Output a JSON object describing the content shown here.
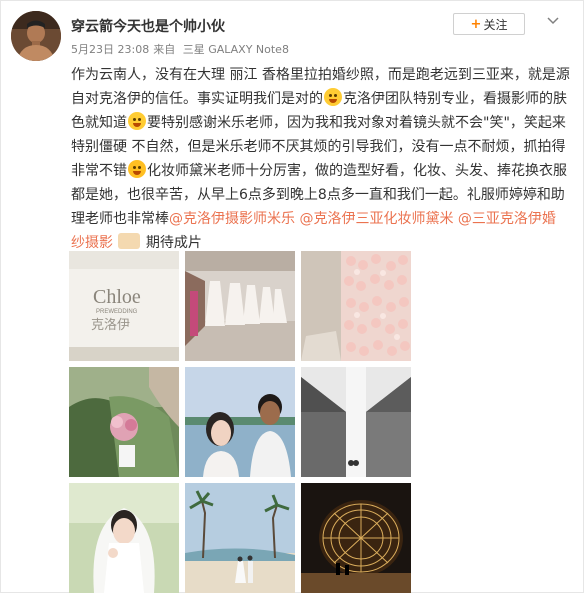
{
  "user": {
    "name": "穿云箭今天也是个帅小伙"
  },
  "meta": {
    "time": "5月23日 23:08",
    "from_prefix": "来自",
    "device": "三星 GALAXY Note8"
  },
  "follow": {
    "label": "关注",
    "plus": "+"
  },
  "post": {
    "l1": "作为云南人，没有在大理 丽江 香格里拉拍婚纱照，而是跑老远到三亚来，就是源",
    "l2a": "自对克洛伊的信任。事实证明我们是对的",
    "l2b": "克洛伊团队特别专业，看摄影师的肤",
    "l3a": "色就知道",
    "l3b": "要特别感谢米乐老师，因为我和我对象对着镜头就不会\"笑\"，笑起来",
    "l4": "特别僵硬 不自然，但是米乐老师不厌其烦的引导我们，没有一点不耐烦，抓拍得",
    "l5a": "非常不错",
    "l5b": "化妆师黛米老师十分厉害，做的造型好看，化妆、头发、捧花换衣服",
    "l6": "都是她，也很辛苦，从早上6点多到晚上8点多一直和我们一起。礼服师婷婷和助",
    "l7a": "理老师也非常棒",
    "mention1": "@克洛伊摄影师米乐",
    "mention2": "@克洛伊三亚化妆师黛米",
    "mention3a": "@三亚克洛伊婚",
    "mention3b": "纱摄影",
    "l8": "期待成片"
  },
  "photos": [
    {
      "caption": "Chloe",
      "subcaption": "PREWEDDING",
      "brand": "克洛伊"
    },
    {},
    {},
    {},
    {},
    {},
    {},
    {},
    {}
  ]
}
